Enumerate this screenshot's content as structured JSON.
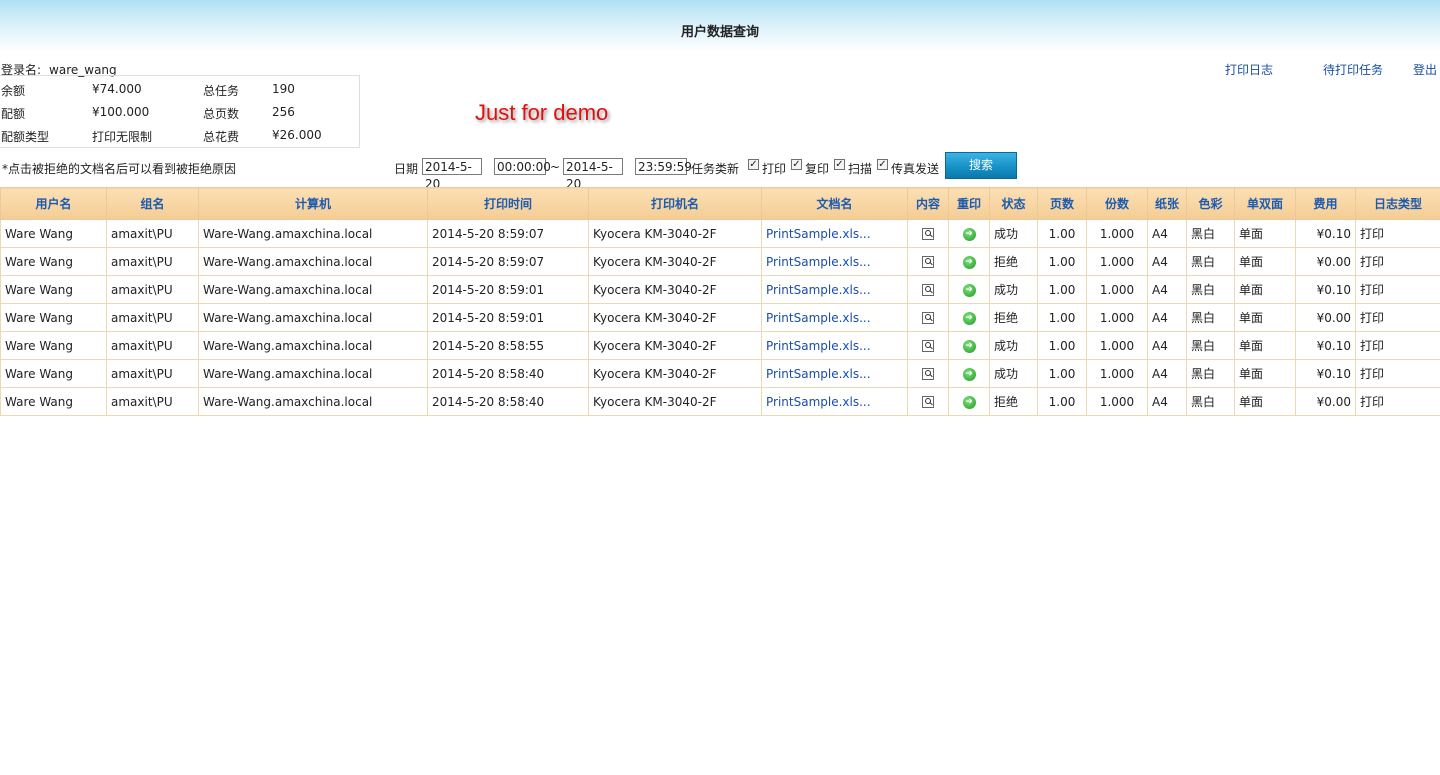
{
  "header": {
    "title": "用户数据查询"
  },
  "login": {
    "label": "登录名:",
    "value": "ware_wang"
  },
  "top_links": {
    "print_log": "打印日志",
    "pending_tasks": "待打印任务",
    "logout": "登出"
  },
  "info": {
    "balance_label": "余额",
    "balance": "¥74.000",
    "total_tasks_label": "总任务",
    "total_tasks": "190",
    "quota_label": "配额",
    "quota": "¥100.000",
    "total_pages_label": "总页数",
    "total_pages": "256",
    "quota_type_label": "配额类型",
    "quota_type": "打印无限制",
    "total_cost_label": "总花费",
    "total_cost": "¥26.000"
  },
  "demo_text": "Just for demo",
  "note": "*点击被拒绝的文档名后可以看到被拒绝原因",
  "search": {
    "date_label": "日期",
    "start_date": "2014-5-20",
    "start_time": "00:00:00",
    "tilde": "~",
    "end_date": "2014-5-20",
    "end_time": "23:59:59",
    "task_type_label": "任务类新",
    "opt_print": "打印",
    "opt_copy": "复印",
    "opt_scan": "扫描",
    "opt_fax": "传真发送",
    "checked_mark": "✓",
    "button": "搜索"
  },
  "table": {
    "headers": [
      "用户名",
      "组名",
      "计算机",
      "打印时间",
      "打印机名",
      "文档名",
      "内容",
      "重印",
      "状态",
      "页数",
      "份数",
      "纸张",
      "色彩",
      "单双面",
      "费用",
      "日志类型"
    ],
    "rows": [
      [
        "Ware Wang",
        "amaxit\\PU",
        "Ware-Wang.amaxchina.local",
        "2014-5-20 8:59:07",
        "Kyocera KM-3040-2F",
        "PrintSample.xls...",
        "",
        "",
        "成功",
        "1.00",
        "1.000",
        "A4",
        "黑白",
        "单面",
        "¥0.10",
        "打印"
      ],
      [
        "Ware Wang",
        "amaxit\\PU",
        "Ware-Wang.amaxchina.local",
        "2014-5-20 8:59:07",
        "Kyocera KM-3040-2F",
        "PrintSample.xls...",
        "",
        "",
        "拒绝",
        "1.00",
        "1.000",
        "A4",
        "黑白",
        "单面",
        "¥0.00",
        "打印"
      ],
      [
        "Ware Wang",
        "amaxit\\PU",
        "Ware-Wang.amaxchina.local",
        "2014-5-20 8:59:01",
        "Kyocera KM-3040-2F",
        "PrintSample.xls...",
        "",
        "",
        "成功",
        "1.00",
        "1.000",
        "A4",
        "黑白",
        "单面",
        "¥0.10",
        "打印"
      ],
      [
        "Ware Wang",
        "amaxit\\PU",
        "Ware-Wang.amaxchina.local",
        "2014-5-20 8:59:01",
        "Kyocera KM-3040-2F",
        "PrintSample.xls...",
        "",
        "",
        "拒绝",
        "1.00",
        "1.000",
        "A4",
        "黑白",
        "单面",
        "¥0.00",
        "打印"
      ],
      [
        "Ware Wang",
        "amaxit\\PU",
        "Ware-Wang.amaxchina.local",
        "2014-5-20 8:58:55",
        "Kyocera KM-3040-2F",
        "PrintSample.xls...",
        "",
        "",
        "成功",
        "1.00",
        "1.000",
        "A4",
        "黑白",
        "单面",
        "¥0.10",
        "打印"
      ],
      [
        "Ware Wang",
        "amaxit\\PU",
        "Ware-Wang.amaxchina.local",
        "2014-5-20 8:58:40",
        "Kyocera KM-3040-2F",
        "PrintSample.xls...",
        "",
        "",
        "成功",
        "1.00",
        "1.000",
        "A4",
        "黑白",
        "单面",
        "¥0.10",
        "打印"
      ],
      [
        "Ware Wang",
        "amaxit\\PU",
        "Ware-Wang.amaxchina.local",
        "2014-5-20 8:58:40",
        "Kyocera KM-3040-2F",
        "PrintSample.xls...",
        "",
        "",
        "拒绝",
        "1.00",
        "1.000",
        "A4",
        "黑白",
        "单面",
        "¥0.00",
        "打印"
      ]
    ]
  },
  "icons": {
    "content": "magnifier-icon",
    "reprint": "green-arrow-icon"
  },
  "colors": {
    "header_text": "#1d5bb0",
    "link": "#1a4ea6",
    "demo": "#e01010",
    "button": "#1792c8"
  }
}
